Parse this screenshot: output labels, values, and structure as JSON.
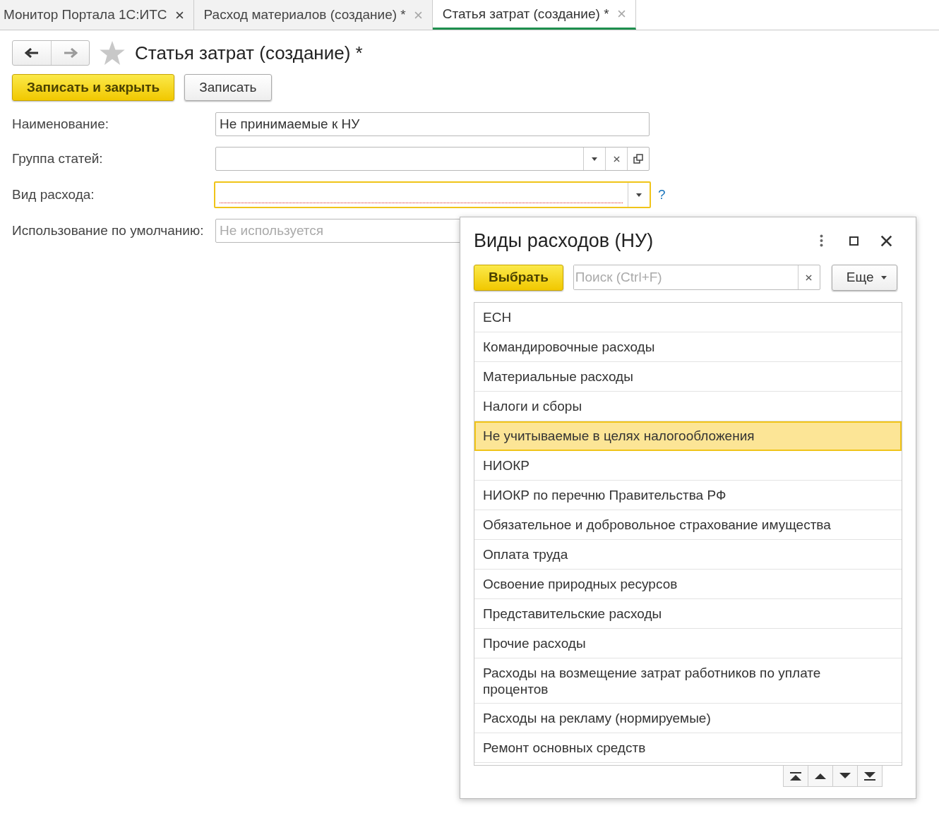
{
  "tabs": [
    {
      "label": "Монитор Портала 1С:ИТС",
      "selected": false
    },
    {
      "label": "Расход материалов (создание) *",
      "selected": false
    },
    {
      "label": "Статья затрат (создание) *",
      "selected": true
    }
  ],
  "form": {
    "title": "Статья затрат (создание) *",
    "buttons": [
      {
        "label": "Записать и закрыть",
        "kind": "primary"
      },
      {
        "label": "Записать",
        "kind": "default"
      }
    ],
    "fields": [
      {
        "label": "Наименование:",
        "kind": "text",
        "value": "Не принимаемые к НУ",
        "focused": false,
        "required": false
      },
      {
        "label": "Группа статей:",
        "kind": "choice-open",
        "focused": false,
        "required": false
      },
      {
        "label": "Вид расхода:",
        "kind": "choice",
        "focused": true,
        "required": true,
        "help": "?"
      },
      {
        "label": "Использование по умолчанию:",
        "kind": "choice",
        "placeholder": "Не используется",
        "focused": false,
        "required": false
      }
    ]
  },
  "popup": {
    "title": "Виды расходов (НУ)",
    "select_button": "Выбрать",
    "search": {
      "placeholder": "Поиск (Ctrl+F)"
    },
    "more_button": "Еще",
    "items": [
      {
        "label": "ЕСН",
        "selected": false
      },
      {
        "label": "Командировочные расходы",
        "selected": false
      },
      {
        "label": "Материальные расходы",
        "selected": false
      },
      {
        "label": "Налоги и сборы",
        "selected": false
      },
      {
        "label": "Не учитываемые в целях налогообложения",
        "selected": true
      },
      {
        "label": "НИОКР",
        "selected": false
      },
      {
        "label": "НИОКР по перечню Правительства РФ",
        "selected": false
      },
      {
        "label": "Обязательное и добровольное страхование имущества",
        "selected": false
      },
      {
        "label": "Оплата труда",
        "selected": false
      },
      {
        "label": "Освоение природных ресурсов",
        "selected": false
      },
      {
        "label": "Представительские расходы",
        "selected": false
      },
      {
        "label": "Прочие расходы",
        "selected": false
      },
      {
        "label": "Расходы на возмещение затрат работников по уплате процентов",
        "selected": false
      },
      {
        "label": "Расходы на рекламу (нормируемые)",
        "selected": false
      },
      {
        "label": "Ремонт основных средств",
        "selected": false
      }
    ]
  }
}
